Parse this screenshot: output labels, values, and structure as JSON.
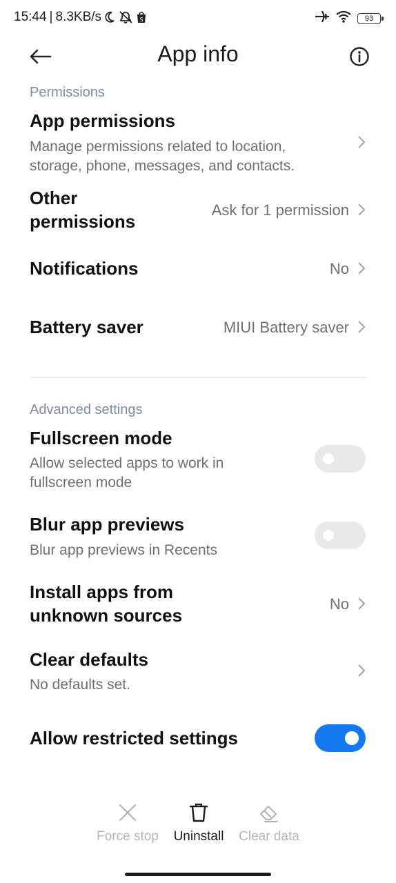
{
  "status_bar": {
    "time": "15:44",
    "separator": "|",
    "net_speed": "8.3KB/s",
    "battery": "93",
    "left_icons": [
      "moon-icon",
      "alarm-off-icon",
      "shopping-bag-icon"
    ],
    "right_icons": [
      "airplane-icon",
      "wifi-icon",
      "battery-icon"
    ]
  },
  "header": {
    "title": "App info",
    "back_icon": "back-arrow-icon",
    "info_icon": "info-icon"
  },
  "permissions_section": {
    "label": "Permissions",
    "app_permissions": {
      "title": "App permissions",
      "subtitle_line1": "Manage permissions related to location,",
      "subtitle_line2": "storage, phone, messages, and contacts."
    },
    "other_permissions": {
      "title_line1": "Other",
      "title_line2": "permissions",
      "value": "Ask for 1 permission"
    },
    "notifications": {
      "title": "Notifications",
      "value": "No"
    },
    "battery_saver": {
      "title": "Battery saver",
      "value": "MIUI Battery saver"
    }
  },
  "advanced_section": {
    "label": "Advanced settings",
    "fullscreen_mode": {
      "title": "Fullscreen mode",
      "subtitle_line1": "Allow selected apps to work in",
      "subtitle_line2": "fullscreen mode",
      "enabled": false
    },
    "blur_previews": {
      "title": "Blur app previews",
      "subtitle": "Blur app previews in Recents",
      "enabled": false
    },
    "install_unknown": {
      "title_line1": "Install apps from",
      "title_line2": "unknown sources",
      "value": "No"
    },
    "clear_defaults": {
      "title": "Clear defaults",
      "subtitle": "No defaults set."
    },
    "allow_restricted": {
      "title": "Allow restricted settings",
      "enabled": true
    }
  },
  "actions": {
    "force_stop": {
      "label": "Force stop",
      "icon": "close-x-icon",
      "enabled": false
    },
    "uninstall": {
      "label": "Uninstall",
      "icon": "trash-icon",
      "enabled": true
    },
    "clear_data": {
      "label": "Clear data",
      "icon": "eraser-icon",
      "enabled": false
    }
  },
  "colors": {
    "accent": "#1478f0",
    "section_label": "#7d8ba6",
    "secondary_text": "#707070",
    "toggle_off": "#e9e9e9",
    "disabled_action": "#b5b5b5"
  }
}
